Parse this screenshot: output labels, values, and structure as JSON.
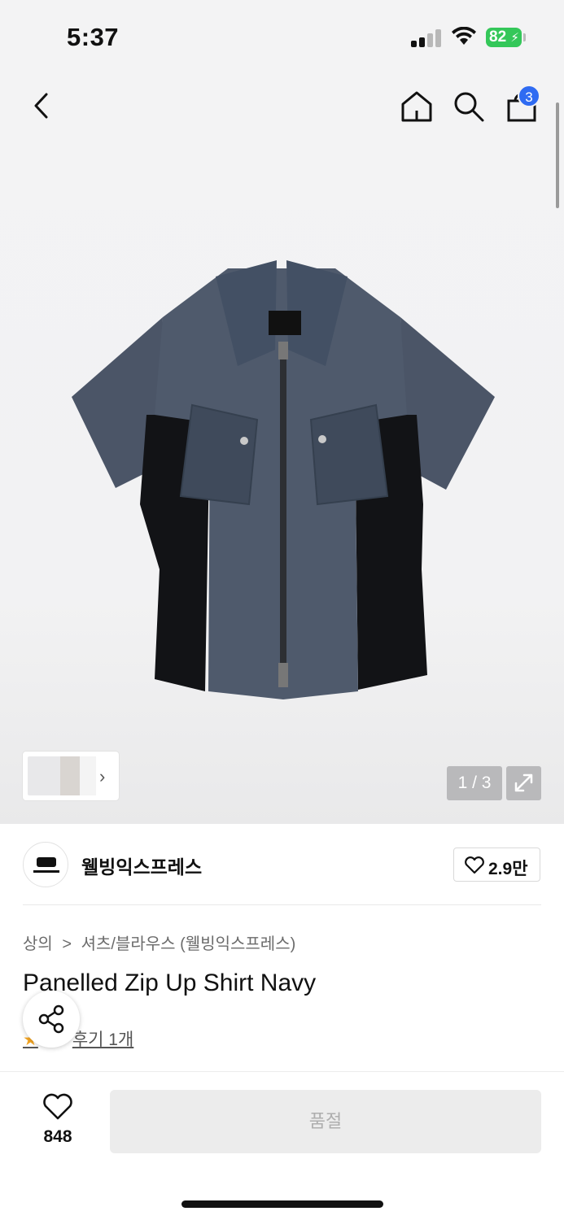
{
  "status": {
    "time": "5:37",
    "battery": "82"
  },
  "nav": {
    "cart_count": "3"
  },
  "gallery": {
    "page_counter": "1 / 3"
  },
  "brand": {
    "name": "웰빙익스프레스",
    "likes": "2.9만"
  },
  "breadcrumb": {
    "category": "상의",
    "separator": ">",
    "subcategory": "셔츠/블라우스 (웰빙익스프레스)"
  },
  "product": {
    "title": "Panelled Zip Up Shirt Navy",
    "review_link": "후기 1개"
  },
  "bottom": {
    "wish_count": "848",
    "buy_label": "품절"
  },
  "colors": {
    "accent": "#2f6bf2",
    "battery": "#34c759",
    "shirt_navy": "#4a5566",
    "panel_black": "#121316"
  },
  "icons": [
    "back-icon",
    "home-icon",
    "search-icon",
    "cart-icon",
    "expand-icon",
    "heart-icon",
    "share-icon",
    "star-icon"
  ]
}
